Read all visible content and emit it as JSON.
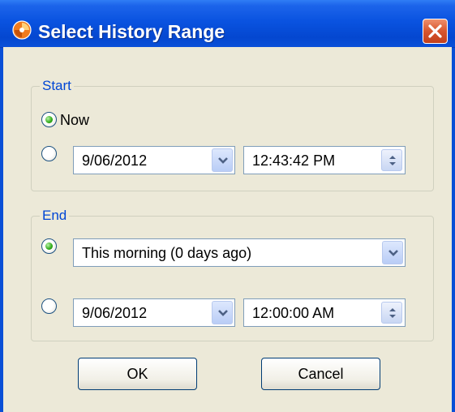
{
  "dialog": {
    "title": "Select History Range",
    "accent": "#0a53e0"
  },
  "start": {
    "label": "Start",
    "now_label": "Now",
    "now_selected": true,
    "date": "9/06/2012",
    "time": "12:43:42 PM"
  },
  "end": {
    "label": "End",
    "preset_selected": true,
    "preset_value": "This morning (0 days ago)",
    "date": "9/06/2012",
    "time": "12:00:00 AM"
  },
  "buttons": {
    "ok": "OK",
    "cancel": "Cancel"
  },
  "icons": {
    "app": "app-logo-icon",
    "close": "close-icon",
    "dropdown": "chevron-down-icon",
    "spinner": "spinner-icon"
  }
}
